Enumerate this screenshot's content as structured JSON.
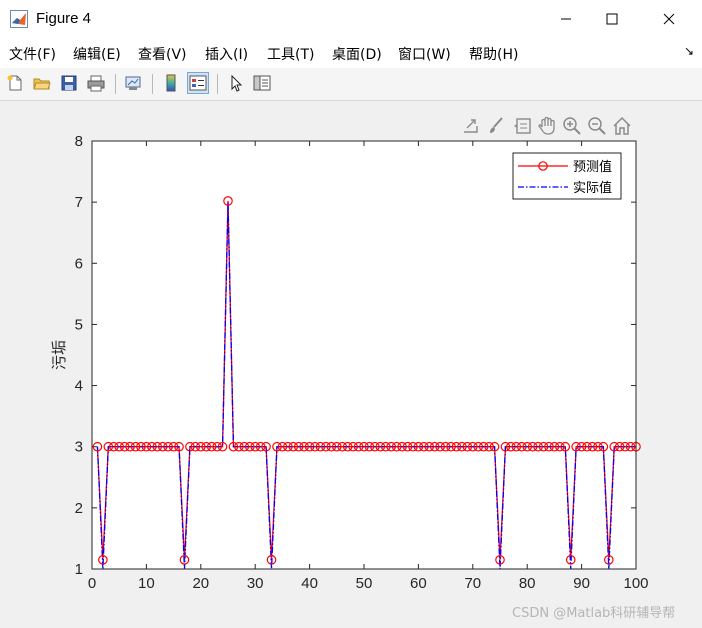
{
  "window": {
    "title": "Figure 4"
  },
  "menu": [
    "文件(F)",
    "编辑(E)",
    "查看(V)",
    "插入(I)",
    "工具(T)",
    "桌面(D)",
    "窗口(W)",
    "帮助(H)"
  ],
  "menu_overflow_icon": "chevron-icon",
  "toolbar_icons": [
    "new-figure-icon",
    "open-file-icon",
    "save-icon",
    "print-icon",
    "link-plot-icon",
    "colorbar-icon",
    "legend-icon",
    "pointer-icon",
    "property-inspector-icon"
  ],
  "axes_toolbar_icons": [
    "export-icon",
    "brush-icon",
    "datatip-icon",
    "pan-icon",
    "zoom-in-icon",
    "zoom-out-icon",
    "home-icon"
  ],
  "watermark": "CSDN @Matlab科研辅导帮",
  "colors": {
    "predicted": "#ff0000",
    "actual": "#0000ff",
    "plot_bg": "#ffffff",
    "figure_bg": "#f0f0f0"
  },
  "chart_data": {
    "type": "line",
    "title": "",
    "xlabel": "",
    "ylabel": "污垢",
    "xlim": [
      0,
      100
    ],
    "ylim": [
      1,
      8
    ],
    "xticks": [
      0,
      10,
      20,
      30,
      40,
      50,
      60,
      70,
      80,
      90,
      100
    ],
    "yticks": [
      1,
      2,
      3,
      4,
      5,
      6,
      7,
      8
    ],
    "grid": false,
    "legend_position": "top-right",
    "x": [
      1,
      2,
      3,
      4,
      5,
      6,
      7,
      8,
      9,
      10,
      11,
      12,
      13,
      14,
      15,
      16,
      17,
      18,
      19,
      20,
      21,
      22,
      23,
      24,
      25,
      26,
      27,
      28,
      29,
      30,
      31,
      32,
      33,
      34,
      35,
      36,
      37,
      38,
      39,
      40,
      41,
      42,
      43,
      44,
      45,
      46,
      47,
      48,
      49,
      50,
      51,
      52,
      53,
      54,
      55,
      56,
      57,
      58,
      59,
      60,
      61,
      62,
      63,
      64,
      65,
      66,
      67,
      68,
      69,
      70,
      71,
      72,
      73,
      74,
      75,
      76,
      77,
      78,
      79,
      80,
      81,
      82,
      83,
      84,
      85,
      86,
      87,
      88,
      89,
      90,
      91,
      92,
      93,
      94,
      95,
      96,
      97,
      98,
      99,
      100
    ],
    "series": [
      {
        "name": "预测值",
        "style": "solid-circle",
        "values": [
          3,
          1.15,
          3,
          3,
          3,
          3,
          3,
          3,
          3,
          3,
          3,
          3,
          3,
          3,
          3,
          3,
          1.15,
          3,
          3,
          3,
          3,
          3,
          3,
          3,
          7.02,
          3,
          3,
          3,
          3,
          3,
          3,
          3,
          1.15,
          3,
          3,
          3,
          3,
          3,
          3,
          3,
          3,
          3,
          3,
          3,
          3,
          3,
          3,
          3,
          3,
          3,
          3,
          3,
          3,
          3,
          3,
          3,
          3,
          3,
          3,
          3,
          3,
          3,
          3,
          3,
          3,
          3,
          3,
          3,
          3,
          3,
          3,
          3,
          3,
          3,
          1.15,
          3,
          3,
          3,
          3,
          3,
          3,
          3,
          3,
          3,
          3,
          3,
          3,
          1.15,
          3,
          3,
          3,
          3,
          3,
          3,
          1.15,
          3,
          3,
          3,
          3,
          3
        ]
      },
      {
        "name": "实际值",
        "style": "dashdot",
        "values": [
          3,
          1,
          3,
          3,
          3,
          3,
          3,
          3,
          3,
          3,
          3,
          3,
          3,
          3,
          3,
          3,
          1,
          3,
          3,
          3,
          3,
          3,
          3,
          3,
          7,
          3,
          3,
          3,
          3,
          3,
          3,
          3,
          1,
          3,
          3,
          3,
          3,
          3,
          3,
          3,
          3,
          3,
          3,
          3,
          3,
          3,
          3,
          3,
          3,
          3,
          3,
          3,
          3,
          3,
          3,
          3,
          3,
          3,
          3,
          3,
          3,
          3,
          3,
          3,
          3,
          3,
          3,
          3,
          3,
          3,
          3,
          3,
          3,
          3,
          1,
          3,
          3,
          3,
          3,
          3,
          3,
          3,
          3,
          3,
          3,
          3,
          3,
          1,
          3,
          3,
          3,
          3,
          3,
          3,
          1,
          3,
          3,
          3,
          3,
          3
        ]
      }
    ]
  }
}
